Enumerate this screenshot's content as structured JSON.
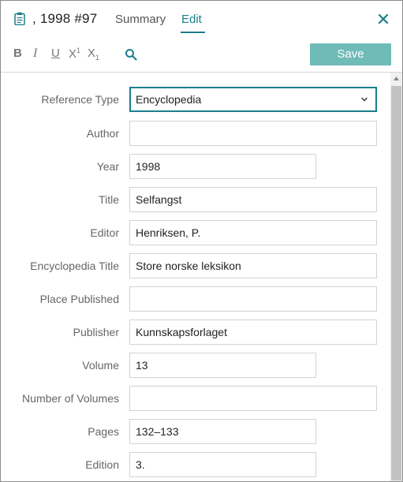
{
  "header": {
    "reference_title": ", 1998 #97",
    "tabs": [
      {
        "label": "Summary",
        "active": false
      },
      {
        "label": "Edit",
        "active": true
      }
    ],
    "icons": {
      "reference": "clipboard-icon",
      "close": "close-icon"
    }
  },
  "toolbar": {
    "bold": "B",
    "italic": "I",
    "underline": "U",
    "superscript": "X",
    "superscript_mark": "1",
    "subscript": "X",
    "subscript_mark": "1",
    "search_icon": "search-icon",
    "save_label": "Save"
  },
  "form": {
    "reference_type": {
      "label": "Reference Type",
      "value": "Encyclopedia"
    },
    "fields": [
      {
        "label": "Author",
        "value": ""
      },
      {
        "label": "Year",
        "value": "1998"
      },
      {
        "label": "Title",
        "value": "Selfangst"
      },
      {
        "label": "Editor",
        "value": "Henriksen, P."
      },
      {
        "label": "Encyclopedia Title",
        "value": "Store norske leksikon"
      },
      {
        "label": "Place Published",
        "value": ""
      },
      {
        "label": "Publisher",
        "value": "Kunnskapsforlaget"
      },
      {
        "label": "Volume",
        "value": "13"
      },
      {
        "label": "Number of Volumes",
        "value": ""
      },
      {
        "label": "Pages",
        "value": "132–133"
      },
      {
        "label": "Edition",
        "value": "3."
      }
    ]
  },
  "colors": {
    "accent": "#1b7f8c",
    "save_button": "#6fbbb8",
    "label_text": "#666666",
    "field_border": "#d3d3d3",
    "scrollbar_thumb": "#c2c2c2"
  }
}
